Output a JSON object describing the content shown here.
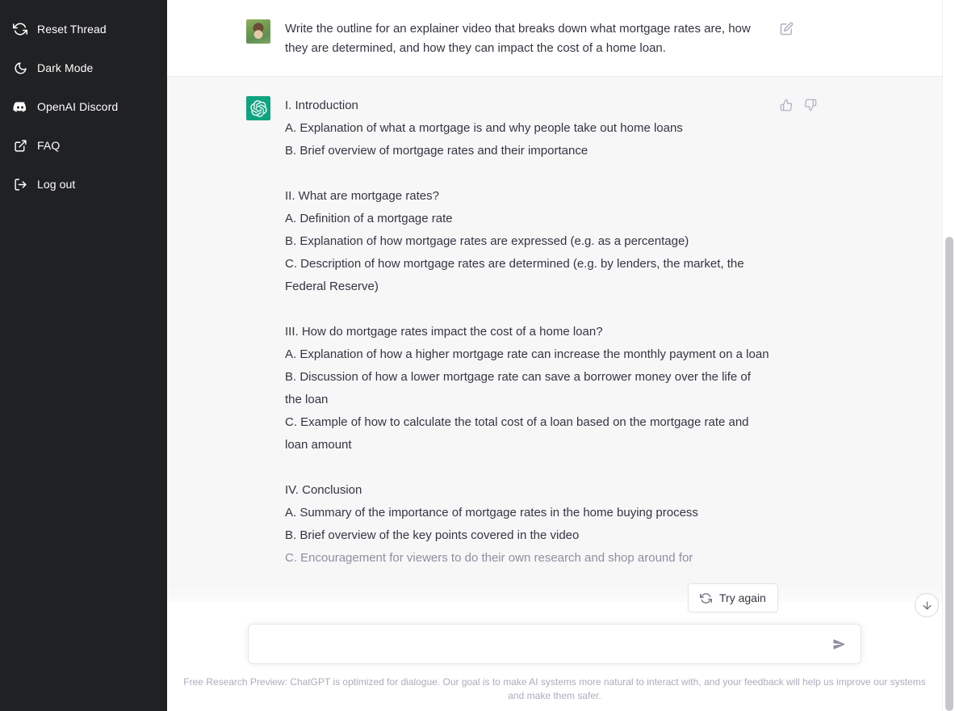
{
  "sidebar": {
    "items": [
      {
        "label": "Reset Thread",
        "icon": "reset-icon"
      },
      {
        "label": "Dark Mode",
        "icon": "moon-icon"
      },
      {
        "label": "OpenAI Discord",
        "icon": "discord-icon"
      },
      {
        "label": "FAQ",
        "icon": "external-link-icon"
      },
      {
        "label": "Log out",
        "icon": "logout-icon"
      }
    ]
  },
  "conversation": {
    "user_message": {
      "text": "Write the outline for an explainer video that breaks down what mortgage rates are, how they are determined, and how they can impact the cost of a home loan.",
      "edit_icon": "edit-pencil-icon"
    },
    "assistant_message": {
      "lines": [
        "I. Introduction",
        "A. Explanation of what a mortgage is and why people take out home loans",
        "B. Brief overview of mortgage rates and their importance",
        "",
        "II. What are mortgage rates?",
        "A. Definition of a mortgage rate",
        "B. Explanation of how mortgage rates are expressed (e.g. as a percentage)",
        "C. Description of how mortgage rates are determined (e.g. by lenders, the market, the Federal Reserve)",
        "",
        "III. How do mortgage rates impact the cost of a home loan?",
        "A. Explanation of how a higher mortgage rate can increase the monthly payment on a loan",
        "B. Discussion of how a lower mortgage rate can save a borrower money over the life of the loan",
        "C. Example of how to calculate the total cost of a loan based on the mortgage rate and loan amount",
        "",
        "IV. Conclusion",
        "A. Summary of the importance of mortgage rates in the home buying process",
        "B. Brief overview of the key points covered in the video"
      ],
      "cutoff_line": "C. Encouragement for viewers to do their own research and shop around for",
      "thumbs_up_icon": "thumbs-up-icon",
      "thumbs_down_icon": "thumbs-down-icon"
    }
  },
  "try_again": {
    "label": "Try again",
    "icon": "refresh-icon"
  },
  "scroll_down": {
    "icon": "arrow-down-icon"
  },
  "composer": {
    "value": "",
    "placeholder": "",
    "send_icon": "send-arrow-icon"
  },
  "footer": {
    "disclaimer": "Free Research Preview: ChatGPT is optimized for dialogue. Our goal is to make AI systems more natural to interact with, and your feedback will help us improve our systems and make them safer."
  },
  "colors": {
    "sidebar_bg": "#202123",
    "assistant_bg": "#f7f7f8",
    "brand_green": "#10a37f",
    "text": "#343541",
    "muted": "#acacbe"
  }
}
